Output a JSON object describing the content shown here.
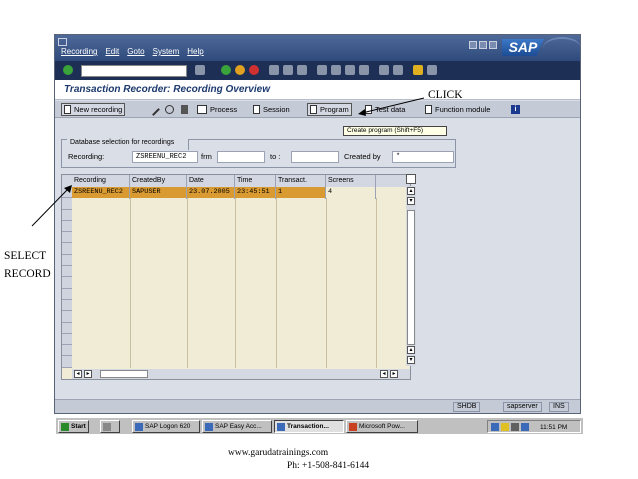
{
  "menu": [
    "Recording",
    "Edit",
    "Goto",
    "System",
    "Help"
  ],
  "brand": "SAP",
  "title": "Transaction Recorder: Recording Overview",
  "toolbar": {
    "new_recording": "New recording",
    "process": "Process",
    "session": "Session",
    "program": "Program",
    "test_data": "Test data",
    "function_module": "Function module"
  },
  "tooltip": "Create program  (Shift+F5)",
  "selection": {
    "section_title": "Database selection for recordings",
    "recording_label": "Recording:",
    "recording_value": "ZSREENU_REC2",
    "frm_label": "frm",
    "to_label": "to :",
    "created_by_label": "Created by",
    "created_by_value": "*"
  },
  "grid": {
    "headers": [
      "Recording",
      "CreatedBy",
      "Date",
      "Time",
      "Transact.",
      "Screens"
    ],
    "rows": [
      [
        "ZSREENU_REC2",
        "SAPUSER",
        "23.07.2005",
        "23:45:51",
        "1",
        "4"
      ]
    ]
  },
  "status": {
    "tcode": "SHDB",
    "server": "sapserver",
    "mode": "INS"
  },
  "taskbar": {
    "start": "Start",
    "tasks": [
      "SAP Logon 620",
      "SAP Easy Acc...",
      "Transaction...",
      "Microsoft Pow..."
    ],
    "clock": "11:51 PM"
  },
  "annotations": {
    "click": "CLICK",
    "select": "SELECT",
    "record": "RECORD"
  },
  "footer": {
    "website": "www.garudatrainings.com",
    "phone": "Ph: +1-508-841-6144"
  },
  "colors": {
    "selected_row": "#d99a32",
    "title_text": "#1c3a6e",
    "menubar": "#2e4a7c"
  }
}
